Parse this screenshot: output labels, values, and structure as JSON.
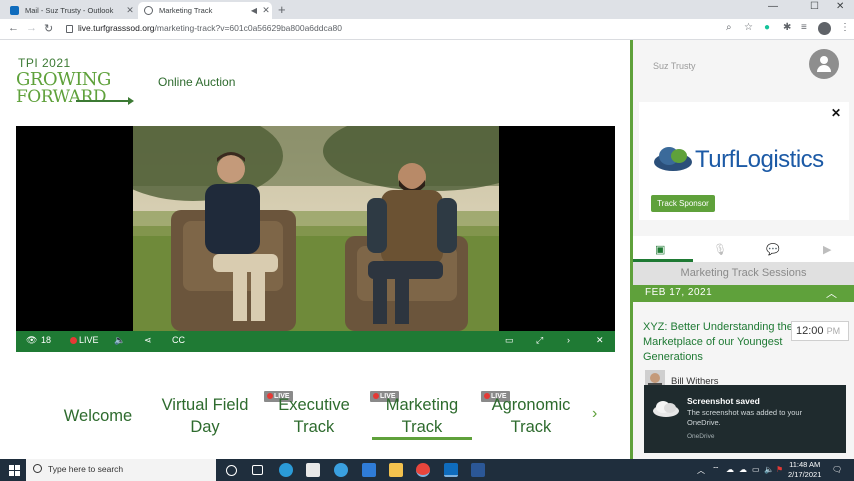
{
  "browser": {
    "tabs": [
      {
        "title": "Mail - Suz Trusty - Outlook",
        "active": false,
        "icon": "outlook-icon"
      },
      {
        "title": "Marketing Track",
        "active": true,
        "icon": "globe-icon"
      }
    ],
    "url_host": "live.turfgrasssod.org",
    "url_path": "/marketing-track?v=601c0a56629ba800a6ddca80"
  },
  "page": {
    "logo": {
      "line1": "TPI 2021",
      "line2": "GROWING",
      "line3": "FORWARD"
    },
    "auction_link": "Online Auction",
    "video_controls": {
      "viewers": "18",
      "live": "LIVE",
      "captions": "CC"
    },
    "tracks": [
      {
        "label_line1": "Welcome",
        "label_line2": "",
        "live": false,
        "active": false
      },
      {
        "label_line1": "Virtual Field",
        "label_line2": "Day",
        "live": false,
        "active": false
      },
      {
        "label_line1": "Executive",
        "label_line2": "Track",
        "live": true,
        "active": false
      },
      {
        "label_line1": "Marketing",
        "label_line2": "Track",
        "live": true,
        "active": true
      },
      {
        "label_line1": "Agronomic",
        "label_line2": "Track",
        "live": true,
        "active": false
      }
    ],
    "live_badge": "LIVE"
  },
  "panel": {
    "user_name": "Suz Trusty",
    "sponsor": {
      "name": "TurfLogistics",
      "button": "Track Sponsor"
    },
    "tabs": [
      "agenda-icon",
      "microphone-icon",
      "chat-icon",
      "play-icon"
    ],
    "sessions_title": "Marketing Track Sessions",
    "date": "FEB 17, 2021",
    "session": {
      "title": "XYZ: Better Understanding the Marketplace of our Youngest Generations",
      "time": "12:00",
      "ampm": "PM",
      "speaker": "Bill Withers"
    }
  },
  "toast": {
    "title": "Screenshot saved",
    "body": "The screenshot was added to your OneDrive.",
    "source": "OneDrive"
  },
  "taskbar": {
    "search_placeholder": "Type here to search",
    "time": "11:48 AM",
    "date": "2/17/2021"
  },
  "colors": {
    "brand_green": "#1f7a34",
    "accent_green": "#5fa13b",
    "sponsor_blue": "#1c5aa6",
    "live_red": "#e53935"
  }
}
